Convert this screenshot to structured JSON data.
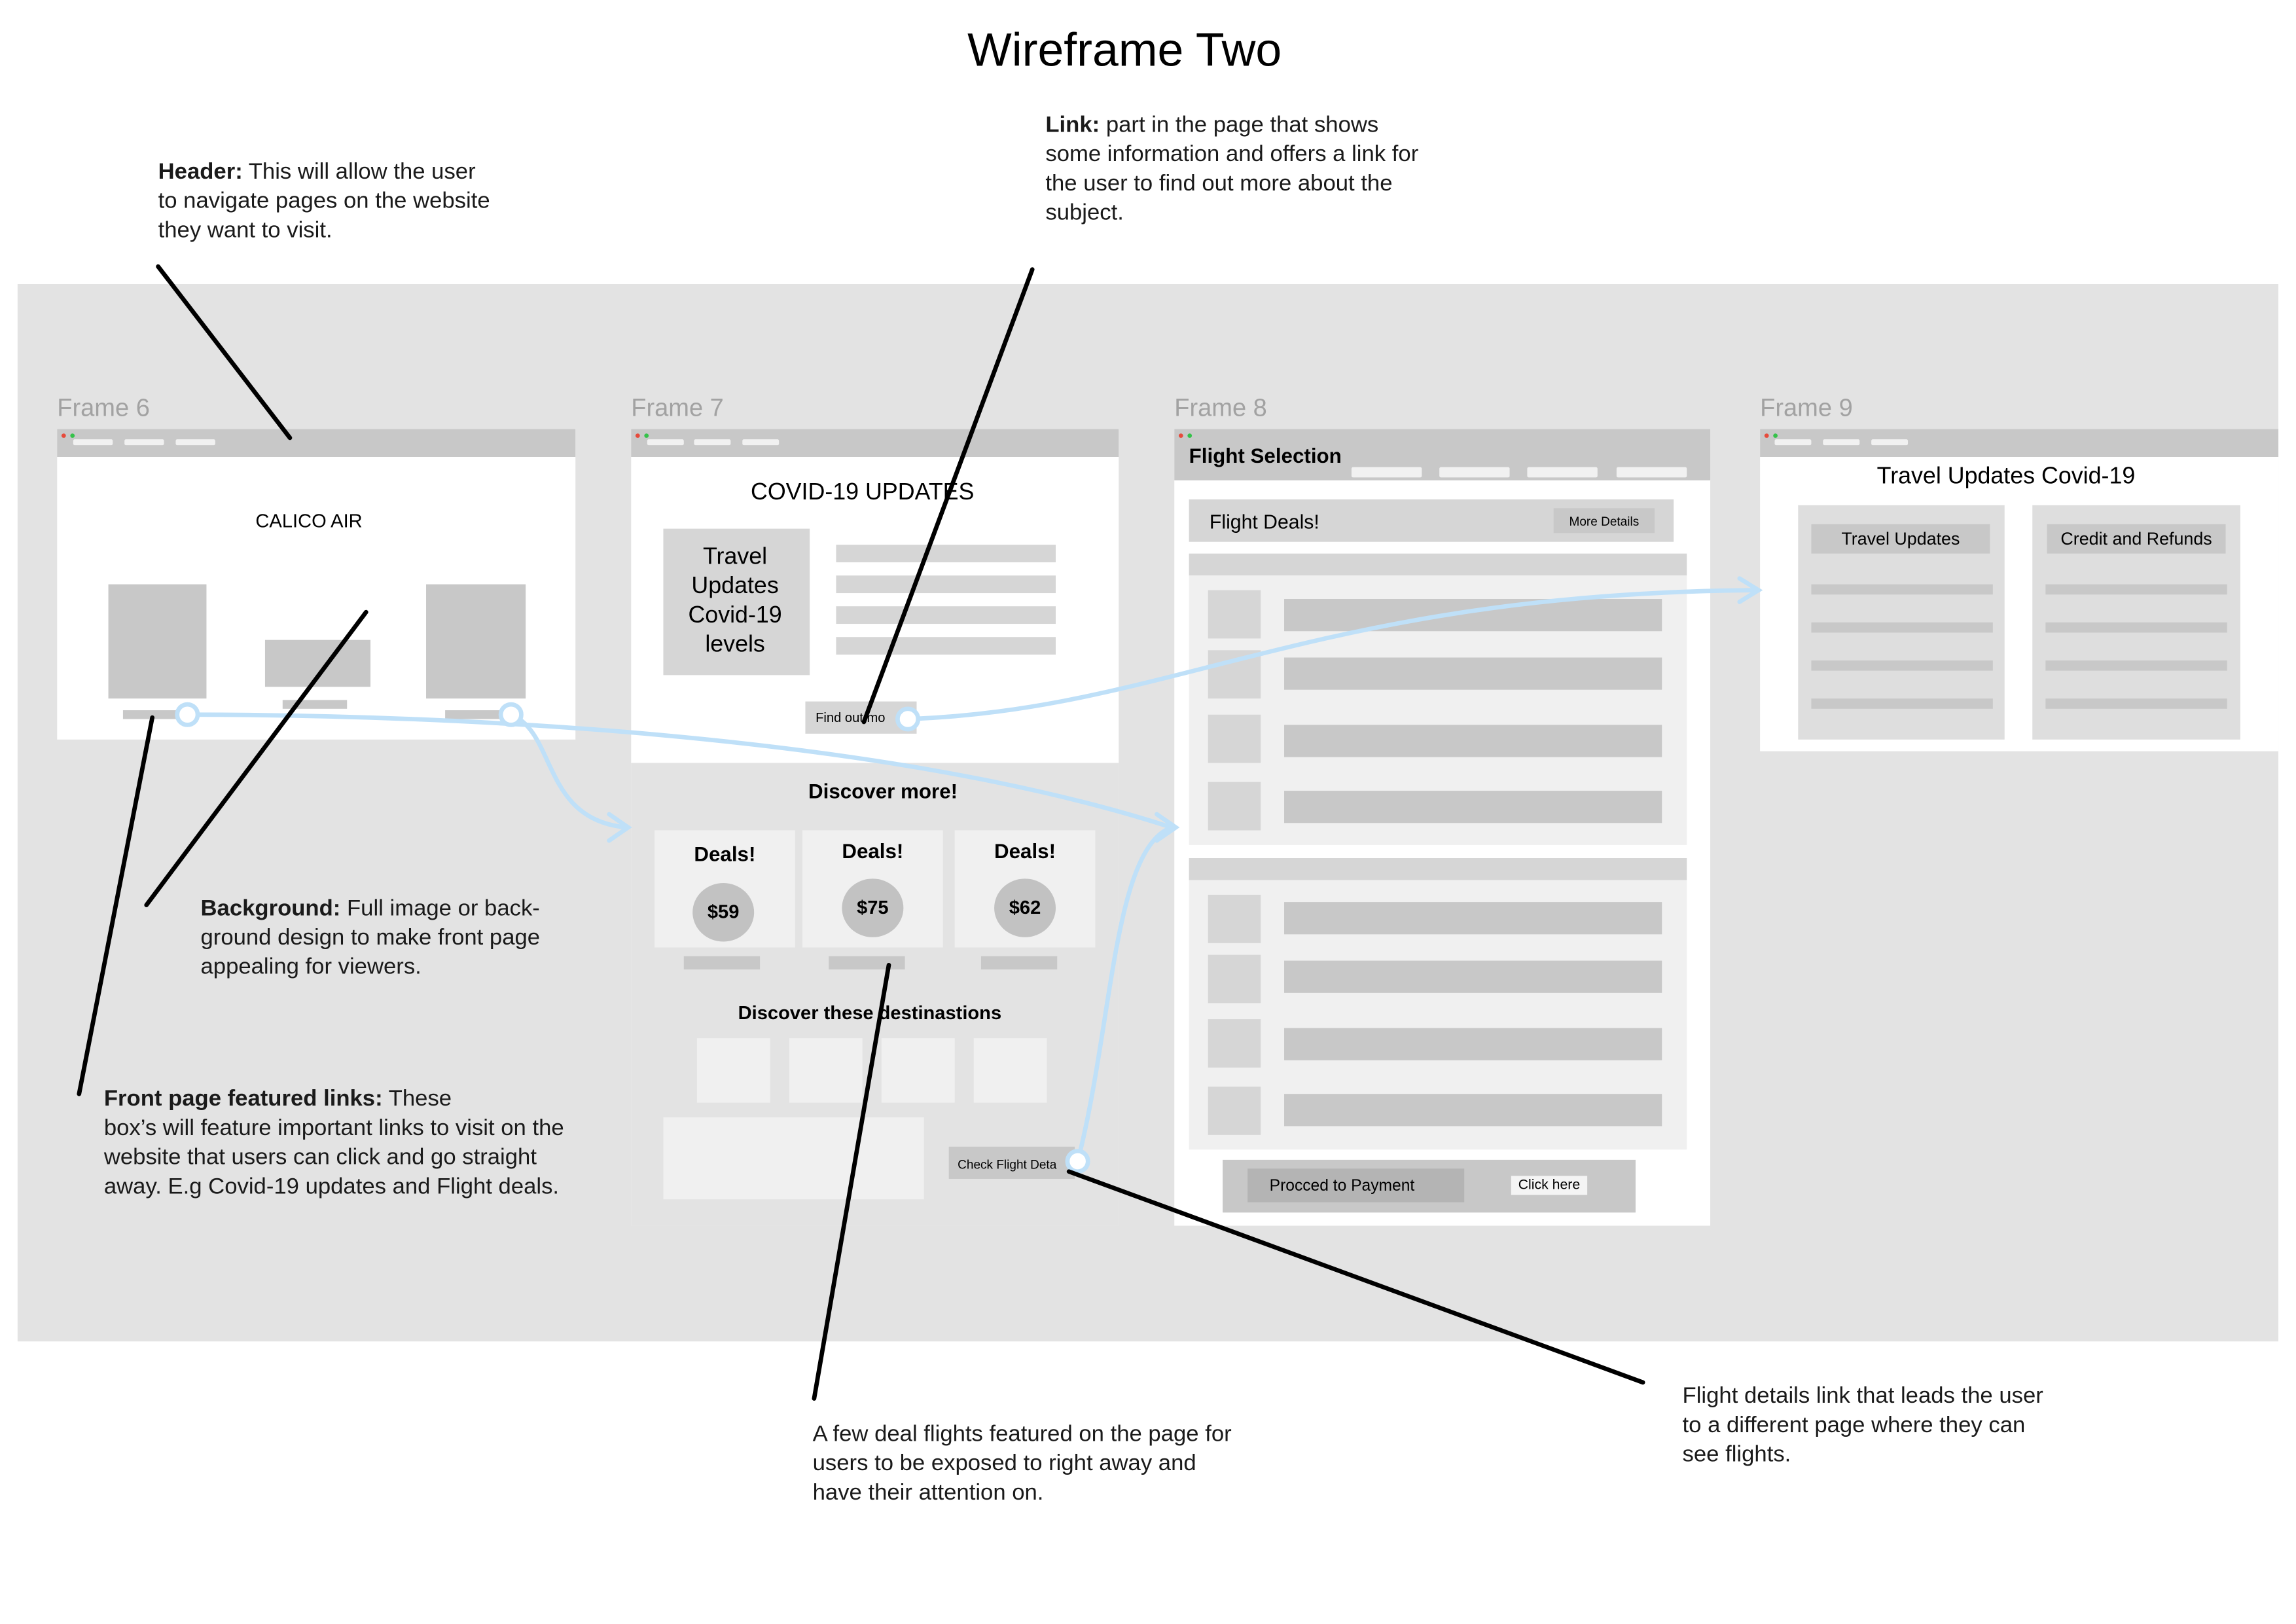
{
  "title": "Wireframe Two",
  "annotations": {
    "header": {
      "bold": "Header:",
      "text": " This will allow the user\nto navigate pages on the website\nthey want to visit."
    },
    "link": {
      "bold": "Link:",
      "text": " part in the page that shows\nsome information and offers a link for\nthe user to find out more about the\nsubject."
    },
    "background": {
      "bold": "Background:",
      "text": " Full image or back-\nground design to make front page\nappealing for viewers."
    },
    "featured_links": {
      "bold": "Front page featured links:",
      "text": " These\nbox’s will feature important links to visit on the\nwebsite that users can click and go straight\naway. E.g Covid-19 updates and Flight deals."
    },
    "deals": {
      "text": "A few deal flights featured on the page for\nusers to be exposed to right away and\nhave their attention on."
    },
    "flight_details": {
      "text": "Flight details link that leads the user\nto a different page where they can\nsee flights."
    }
  },
  "frames": {
    "frame6": {
      "label": "Frame 6",
      "brand": "CALICO AIR"
    },
    "frame7": {
      "label": "Frame 7",
      "heading": "COVID-19 UPDATES",
      "card_text": "Travel\nUpdates\nCovid-19\nlevels",
      "find_out_more": "Find out mo",
      "discover_more": "Discover more!",
      "deals": [
        {
          "label": "Deals!",
          "price": "$59"
        },
        {
          "label": "Deals!",
          "price": "$75"
        },
        {
          "label": "Deals!",
          "price": "$62"
        }
      ],
      "destinations_heading": "Discover these destinastions",
      "check_flight": "Check Flight Deta"
    },
    "frame8": {
      "label": "Frame 8",
      "heading": "Flight Selection",
      "flight_deals": "Flight Deals!",
      "more_details": "More Details",
      "proceed": "Procced to Payment",
      "click_here": "Click here"
    },
    "frame9": {
      "label": "Frame 9",
      "heading": "Travel Updates Covid-19",
      "col1": "Travel Updates",
      "col2": "Credit and Refunds"
    }
  },
  "colors": {
    "canvas": "#e3e3e3",
    "frame": "#ffffff",
    "placeholder": "#c8c8c8",
    "connector": "#bfe0f8",
    "callout_line": "#000000",
    "dot_red": "#e64b3c",
    "dot_green": "#35c24a"
  }
}
